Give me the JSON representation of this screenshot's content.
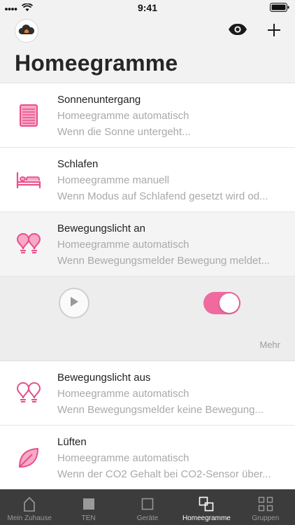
{
  "status_bar": {
    "time": "9:41"
  },
  "header": {
    "title": "Homeegramme"
  },
  "colors": {
    "accent": "#e8508a",
    "toggle_on": "#f06aa0",
    "tabbar_bg": "#3c3c3c"
  },
  "items": [
    {
      "icon": "shutter-icon",
      "title": "Sonnenuntergang",
      "subtitle": "Homeegramme automatisch",
      "description": "Wenn die Sonne untergeht..."
    },
    {
      "icon": "bed-icon",
      "title": "Schlafen",
      "subtitle": "Homeegramme manuell",
      "description": "Wenn Modus auf Schlafend gesetzt wird od..."
    },
    {
      "icon": "double-bulb-icon",
      "title": "Bewegungslicht an",
      "subtitle": "Homeegramme automatisch",
      "description": "Wenn Bewegungsmelder Bewegung meldet..."
    },
    {
      "icon": "double-bulb-icon",
      "title": "Bewegungslicht aus",
      "subtitle": "Homeegramme automatisch",
      "description": "Wenn Bewegungsmelder keine Bewegung..."
    },
    {
      "icon": "leaf-icon",
      "title": "Lüften",
      "subtitle": "Homeegramme automatisch",
      "description": "Wenn der CO2 Gehalt bei CO2-Sensor über..."
    }
  ],
  "expanded": {
    "more_label": "Mehr",
    "toggle_on": true
  },
  "tabs": [
    {
      "label": "Mein Zuhause",
      "icon": "house-icon",
      "active": false
    },
    {
      "label": "TEN",
      "icon": "square-filled-icon",
      "active": false
    },
    {
      "label": "Geräte",
      "icon": "square-outline-icon",
      "active": false
    },
    {
      "label": "Homeegramme",
      "icon": "homeegram-icon",
      "active": true
    },
    {
      "label": "Gruppen",
      "icon": "groups-icon",
      "active": false
    }
  ]
}
